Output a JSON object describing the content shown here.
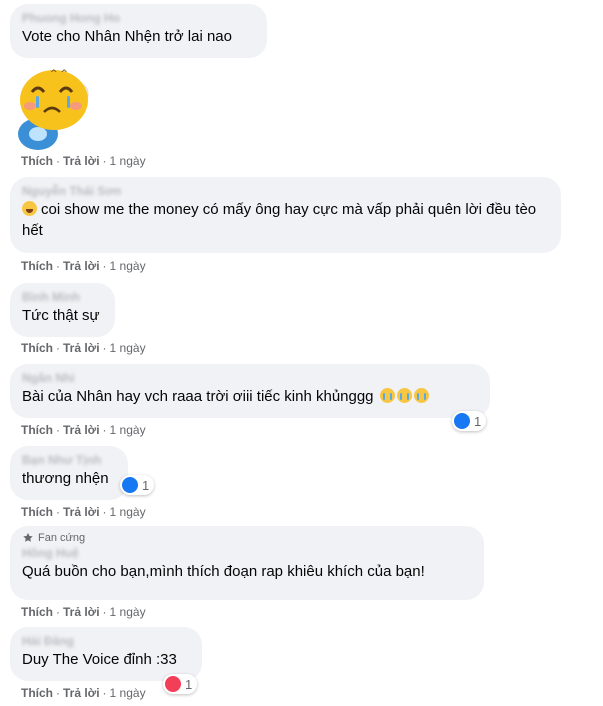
{
  "comments": [
    {
      "author": "Phuong Hong Ho",
      "text": "Vote cho Nhân Nhện trở lai nao"
    },
    {
      "author": "",
      "sticker": "crying-duck-sticker"
    },
    {
      "author": "Nguyễn Thái Sơn",
      "text": "coi show me the money có mấy ông hay cực mà vấp phải quên lời đều tèo hết"
    },
    {
      "author": "Bình Minh",
      "text": "Tức thật sự"
    },
    {
      "author": "Ngân Nhi",
      "text": "Bài của Nhân hay vch raaa trời ơiii tiếc kinh khủnggg",
      "reaction_count": "1"
    },
    {
      "author": "Bạn Như Tịnh",
      "text": "thương nhện",
      "reaction_count": "1"
    },
    {
      "badge": "Fan cứng",
      "author": "Hồng Huệ",
      "text": "Quá buồn cho bạn,mình thích đoạn rap khiêu khích của bạn!"
    },
    {
      "author": "Hải Đăng",
      "text": "Duy The Voice đỉnh :33",
      "reaction_count": "1"
    }
  ],
  "actions": {
    "like": "Thích",
    "reply": "Trả lời",
    "time": "1 ngày",
    "sep": "·"
  },
  "colors": {
    "bubble": "#f0f2f5",
    "like": "#1877f2",
    "love": "#f33e58",
    "meta": "#65676b"
  }
}
